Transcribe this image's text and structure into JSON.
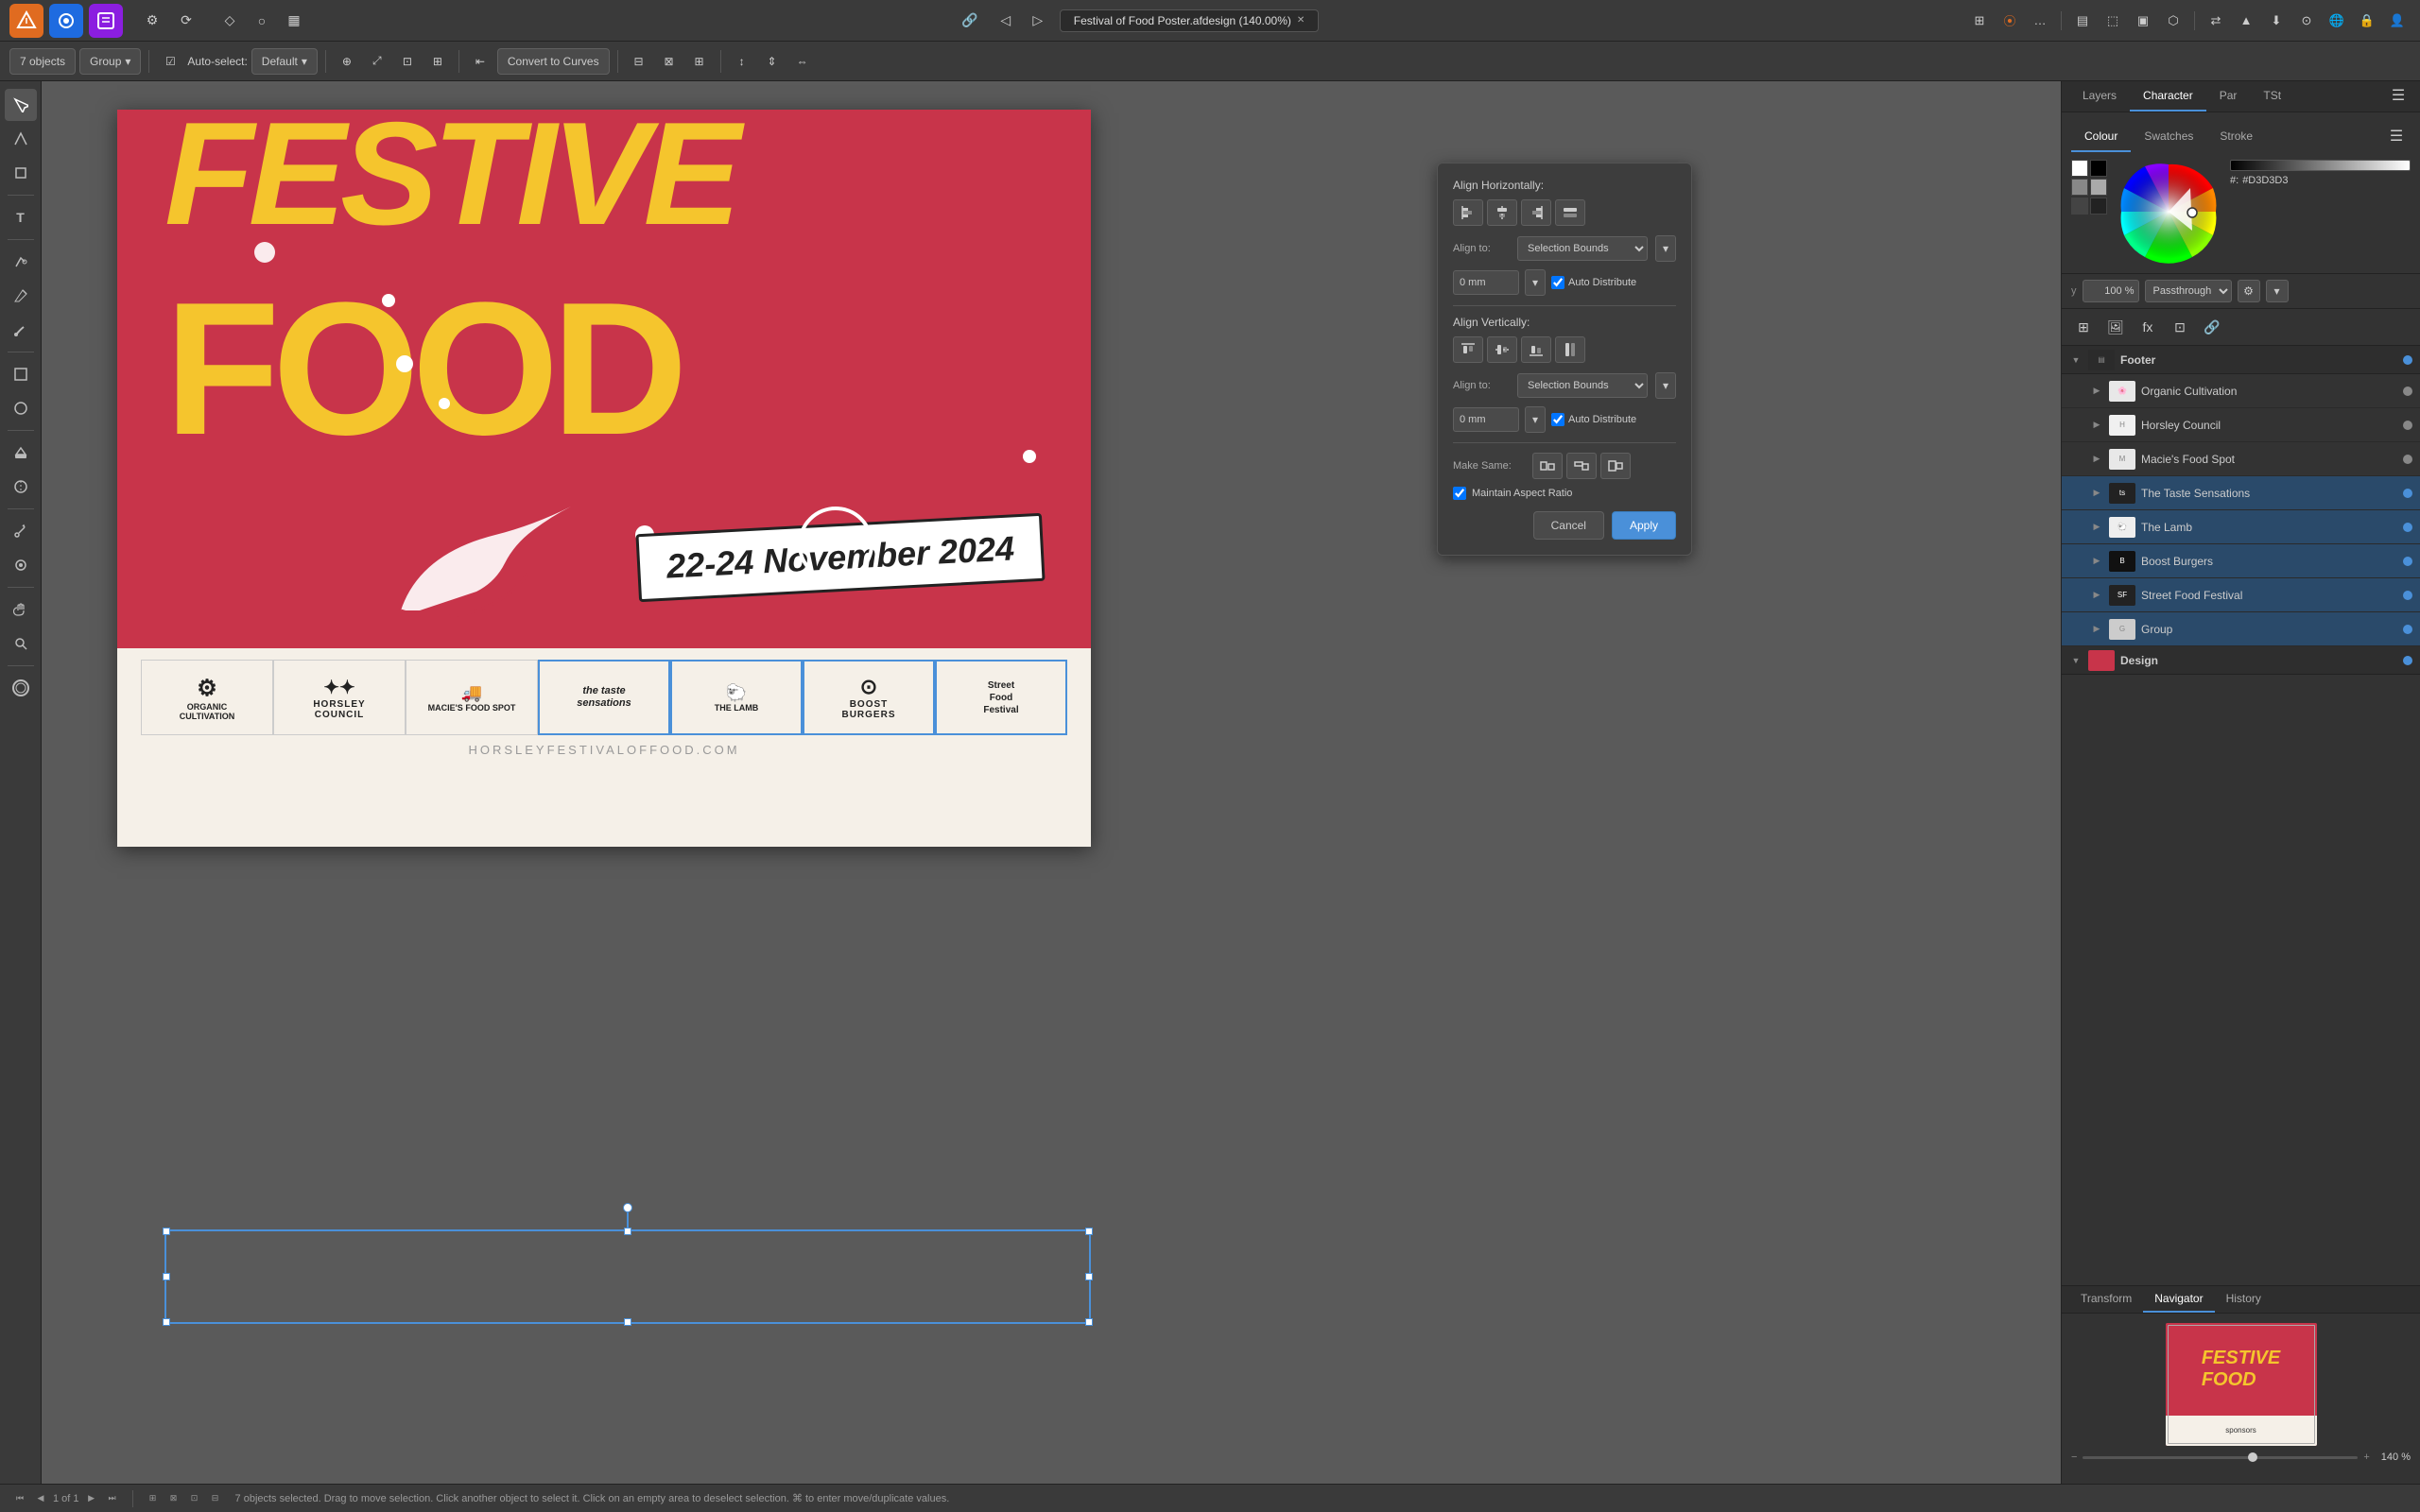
{
  "app": {
    "title": "Festival of Food Poster.afdesign (140.00%)",
    "icons": [
      {
        "name": "affinity-designer",
        "color": "#e06b20",
        "label": "AD"
      },
      {
        "name": "affinity-photo",
        "color": "#1e6be0",
        "label": "AP"
      },
      {
        "name": "affinity-publisher",
        "color": "#8b1ee0",
        "label": "AP2"
      }
    ]
  },
  "toolbar": {
    "objects_count": "7 objects",
    "group_label": "Group",
    "auto_select_label": "Auto-select:",
    "default_label": "Default",
    "convert_to_curves": "Convert to Curves"
  },
  "align_panel": {
    "align_horizontally": "Align Horizontally:",
    "align_to_label": "Align to:",
    "align_to_value": "Selection Bounds",
    "offset_value": "0 mm",
    "auto_distribute": "Auto Distribute",
    "align_vertically": "Align Vertically:",
    "make_same": "Make Same:",
    "maintain_aspect_ratio": "Maintain Aspect Ratio",
    "cancel_label": "Cancel",
    "apply_label": "Apply"
  },
  "right_panel": {
    "tabs": [
      "Colour",
      "Swatches",
      "Stroke"
    ],
    "active_tab": "Colour",
    "hex_value": "#D3D3D3",
    "opacity_value": "100 %",
    "blend_mode": "Passthrough",
    "bottom_tabs": [
      "Transform",
      "Navigator",
      "History"
    ],
    "active_bottom_tab": "Navigator",
    "zoom_level": "140 %"
  },
  "text_tabs": {
    "tabs": [
      "Layers",
      "Character",
      "Par",
      "TSt"
    ],
    "active_tab": "Character"
  },
  "layers": {
    "footer_section": "Footer",
    "items": [
      {
        "name": "Organic Cultivation",
        "indent": 1
      },
      {
        "name": "Horsley Council",
        "indent": 1
      },
      {
        "name": "Macie's Food Spot",
        "indent": 1
      },
      {
        "name": "The Taste Sensations",
        "indent": 1
      },
      {
        "name": "The Lamb",
        "indent": 1
      },
      {
        "name": "Boost Burgers",
        "indent": 1
      },
      {
        "name": "Street Food Festival",
        "indent": 1
      },
      {
        "name": "Group",
        "indent": 1
      }
    ],
    "design_section": "Design"
  },
  "poster": {
    "date_text": "22-24 November 2024",
    "website": "HORSLEYFESTIVALOFFOOD.COM",
    "sponsors": [
      {
        "name": "Organic Cultivation",
        "short": "🌸 ORGANIC\nCULTIVATION"
      },
      {
        "name": "Horsley Council",
        "short": "HORSLEY\nCOUNCIL"
      },
      {
        "name": "Macie's Food Spot",
        "short": "MACIE'S FOOD SPOT"
      },
      {
        "name": "The Taste Sensations",
        "short": "the taste\nsensations"
      },
      {
        "name": "The Lamb",
        "short": "THE LAMB"
      },
      {
        "name": "Boost Burgers",
        "short": "BOOST\nBURGERS"
      },
      {
        "name": "Street Food Festival",
        "short": "Street\nFood\nFestival"
      }
    ]
  },
  "status_bar": {
    "page": "1 of 1",
    "message": "7 objects selected. Drag to move selection. Click another object to select it. Click on an empty area to deselect selection. ⌘ to enter move/duplicate values."
  },
  "right_panel_layers_header": {
    "icons": [
      "grid-icon",
      "photo-icon",
      "fx-icon",
      "transform-icon",
      "link-icon"
    ]
  }
}
